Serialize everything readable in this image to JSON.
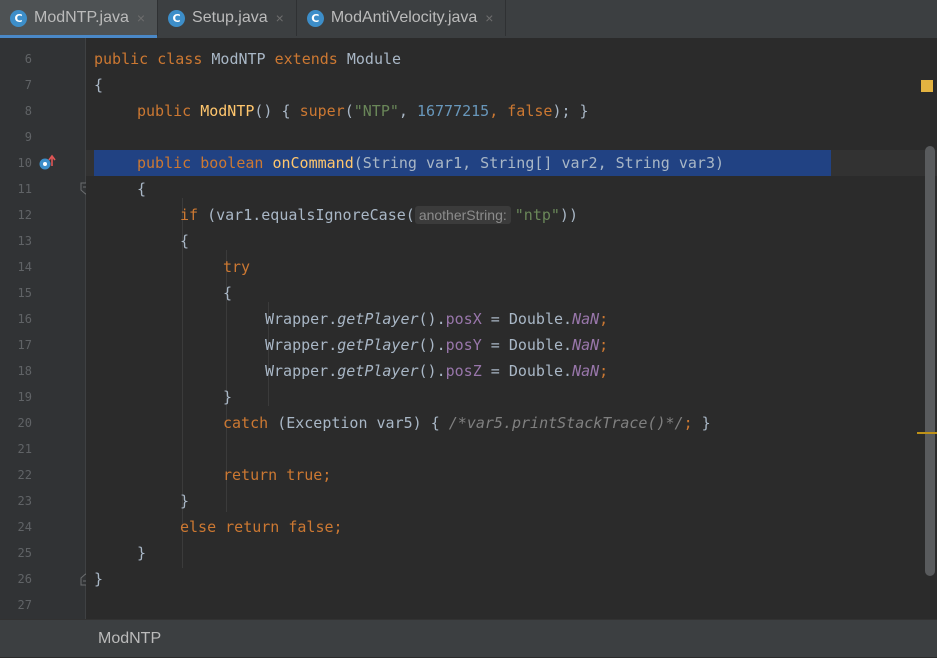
{
  "tabs": [
    {
      "label": "ModNTP.java",
      "icon": "class-icon",
      "active": true
    },
    {
      "label": "Setup.java",
      "icon": "class-icon",
      "active": false
    },
    {
      "label": "ModAntiVelocity.java",
      "icon": "class-icon",
      "active": false
    }
  ],
  "tab_close_glyph": "×",
  "class_icon_letter": "C",
  "line_numbers": [
    "6",
    "7",
    "8",
    "9",
    "10",
    "11",
    "12",
    "13",
    "14",
    "15",
    "16",
    "17",
    "18",
    "19",
    "20",
    "21",
    "22",
    "23",
    "24",
    "25",
    "26",
    "27"
  ],
  "code": {
    "l6": {
      "kw1": "public class ",
      "name": "ModNTP ",
      "kw2": "extends ",
      "parent": "Module"
    },
    "l7": "{",
    "l8": {
      "kw": "public ",
      "fn": "ModNTP",
      "p1": "() { ",
      "kw2": "super",
      "p2": "(",
      "s": "\"NTP\"",
      "p3": ", ",
      "n": "16777215",
      "p4": ", ",
      "kw3": "false",
      "p5": "); }"
    },
    "l10": {
      "kw": "public boolean ",
      "fn": "onCommand",
      "rest": "(String var1, String[] var2, String var3)"
    },
    "l11": "{",
    "l12": {
      "kw": "if ",
      "p1": "(var1.equalsIgnoreCase(",
      "hint": "anotherString:",
      "s": "\"ntp\"",
      "p2": "))"
    },
    "l13": "{",
    "l14": "try",
    "l15": "{",
    "l16": {
      "a": "Wrapper.",
      "m": "getPlayer",
      "b": "().",
      "f": "posX",
      "c": " = Double.",
      "v": "NaN",
      "d": ";"
    },
    "l17": {
      "a": "Wrapper.",
      "m": "getPlayer",
      "b": "().",
      "f": "posY",
      "c": " = Double.",
      "v": "NaN",
      "d": ";"
    },
    "l18": {
      "a": "Wrapper.",
      "m": "getPlayer",
      "b": "().",
      "f": "posZ",
      "c": " = Double.",
      "v": "NaN",
      "d": ";"
    },
    "l19": "}",
    "l20": {
      "kw": "catch ",
      "p1": "(Exception var5) { ",
      "cmt": "/*var5.printStackTrace()*/",
      "semi": ";",
      "p2": " }"
    },
    "l22": {
      "kw": "return true",
      "semi": ";"
    },
    "l23": "}",
    "l24": {
      "kw": "else return false",
      "semi": ";"
    },
    "l25": "}",
    "l26": "}"
  },
  "breadcrumb": "ModNTP",
  "colors": {
    "keyword": "#cc7832",
    "string": "#6a8759",
    "number": "#6897bb",
    "method_decl": "#ffc66d",
    "field": "#9876aa",
    "selection": "#214283"
  }
}
